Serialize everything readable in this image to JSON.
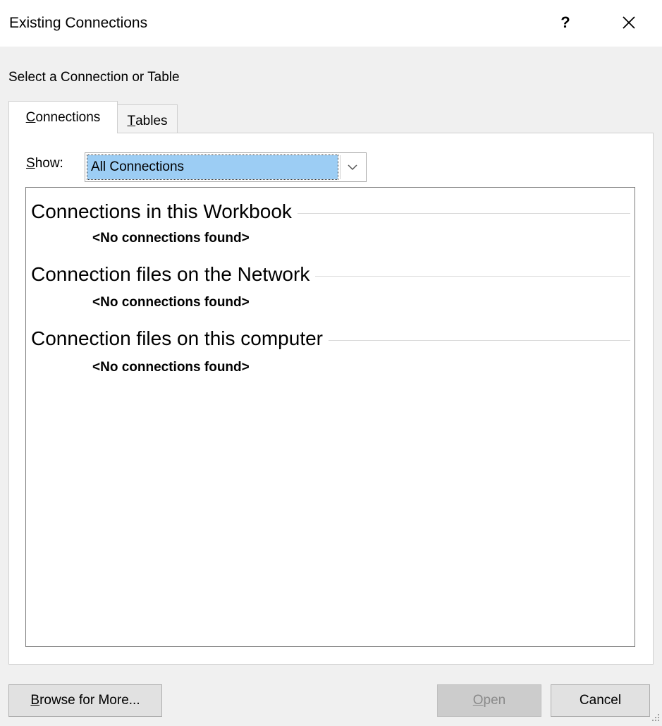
{
  "window": {
    "title": "Existing Connections",
    "help": "?",
    "close_icon": "close-icon"
  },
  "subtitle": "Select a Connection or Table",
  "tabs": [
    {
      "key": "C",
      "rest": "onnections",
      "active": true
    },
    {
      "key": "T",
      "rest": "ables",
      "active": false
    }
  ],
  "show": {
    "label_key": "S",
    "label_rest": "how:",
    "selected": "All Connections",
    "arrow_icon": "chevron-down-icon"
  },
  "groups": [
    {
      "title": "Connections in this Workbook",
      "empty": "<No connections found>"
    },
    {
      "title": "Connection files on the Network",
      "empty": "<No connections found>"
    },
    {
      "title": "Connection files on this computer",
      "empty": "<No connections found>"
    }
  ],
  "buttons": {
    "browse_key": "B",
    "browse_rest": "rowse for More...",
    "open_key": "O",
    "open_rest": "pen",
    "cancel": "Cancel"
  },
  "colors": {
    "selection": "#9ccdf4",
    "disabled_button": "#cccccc"
  }
}
